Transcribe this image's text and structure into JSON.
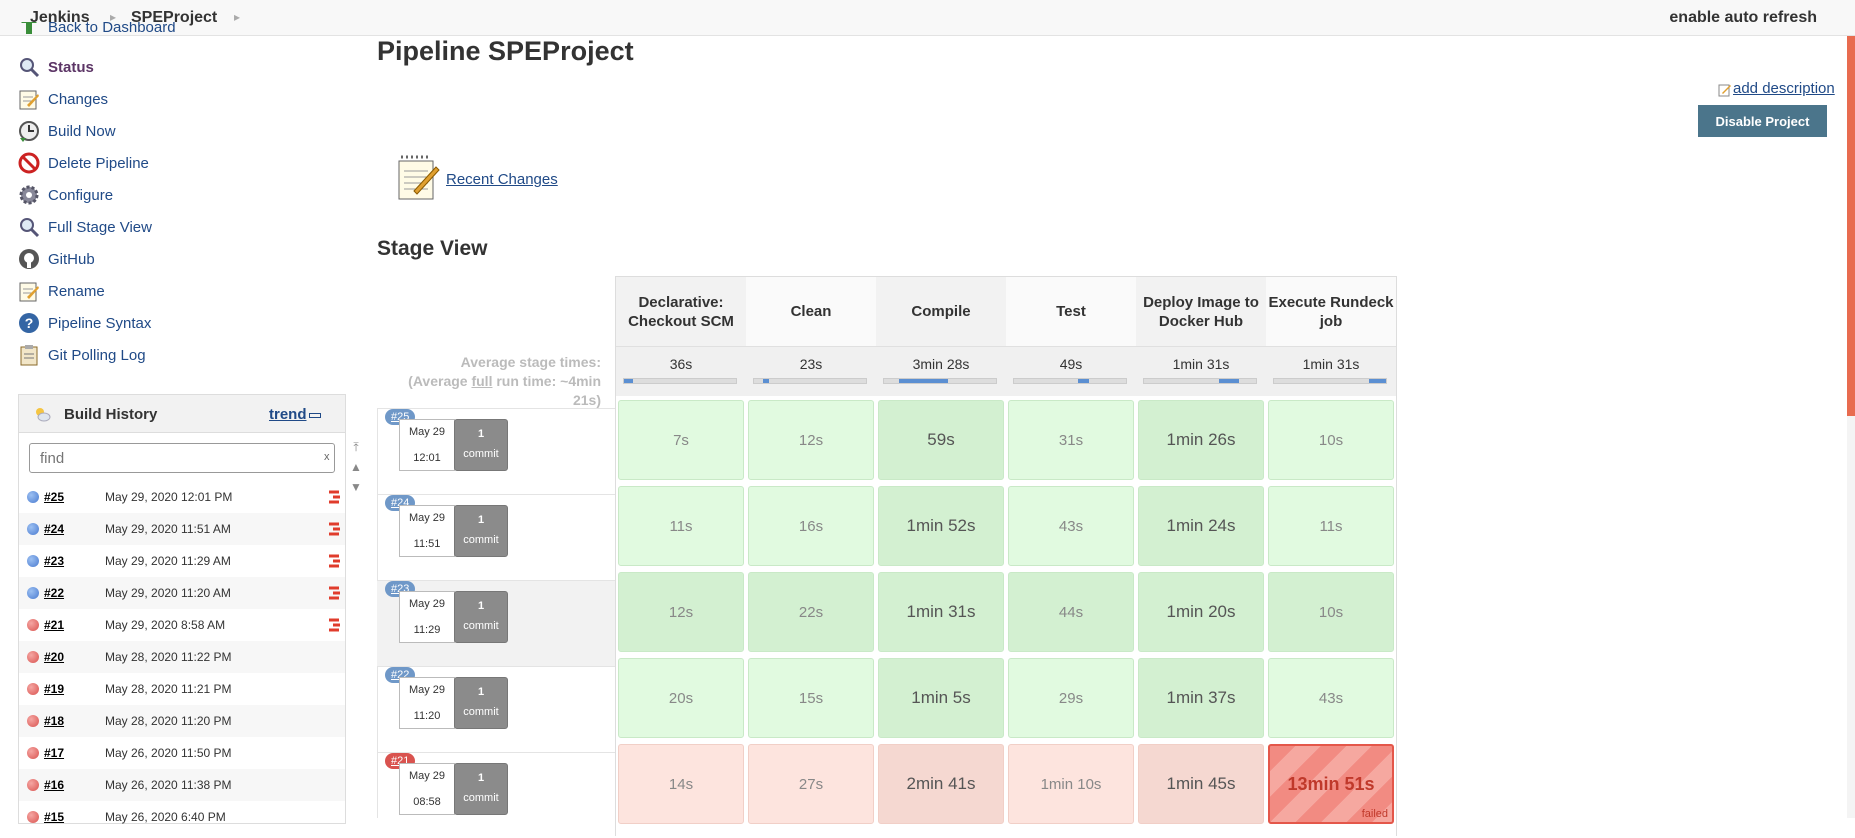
{
  "breadcrumb": {
    "home": "Jenkins",
    "project": "SPEProject"
  },
  "topbar": {
    "auto_refresh": "enable auto refresh"
  },
  "sidebar": {
    "items": [
      {
        "label": "Back to Dashboard",
        "icon": "up-arrow-icon"
      },
      {
        "label": "Status",
        "icon": "magnifier-icon"
      },
      {
        "label": "Changes",
        "icon": "notepad-icon"
      },
      {
        "label": "Build Now",
        "icon": "clock-icon"
      },
      {
        "label": "Delete Pipeline",
        "icon": "no-entry-icon"
      },
      {
        "label": "Configure",
        "icon": "gear-icon"
      },
      {
        "label": "Full Stage View",
        "icon": "magnifier-icon"
      },
      {
        "label": "GitHub",
        "icon": "github-icon"
      },
      {
        "label": "Rename",
        "icon": "notepad-icon"
      },
      {
        "label": "Pipeline Syntax",
        "icon": "help-icon"
      },
      {
        "label": "Git Polling Log",
        "icon": "clipboard-icon"
      }
    ]
  },
  "build_history": {
    "title": "Build History",
    "trend": "trend",
    "find_placeholder": "find",
    "find_clear": "x",
    "builds": [
      {
        "number": "#25",
        "date": "May 29, 2020 12:01 PM",
        "status": "success"
      },
      {
        "number": "#24",
        "date": "May 29, 2020 11:51 AM",
        "status": "success"
      },
      {
        "number": "#23",
        "date": "May 29, 2020 11:29 AM",
        "status": "success"
      },
      {
        "number": "#22",
        "date": "May 29, 2020 11:20 AM",
        "status": "success"
      },
      {
        "number": "#21",
        "date": "May 29, 2020 8:58 AM",
        "status": "failed"
      },
      {
        "number": "#20",
        "date": "May 28, 2020 11:22 PM",
        "status": "failed"
      },
      {
        "number": "#19",
        "date": "May 28, 2020 11:21 PM",
        "status": "failed"
      },
      {
        "number": "#18",
        "date": "May 28, 2020 11:20 PM",
        "status": "failed"
      },
      {
        "number": "#17",
        "date": "May 26, 2020 11:50 PM",
        "status": "failed"
      },
      {
        "number": "#16",
        "date": "May 26, 2020 11:38 PM",
        "status": "failed"
      },
      {
        "number": "#15",
        "date": "May 26, 2020 6:40 PM",
        "status": "failed"
      }
    ]
  },
  "main": {
    "title": "Pipeline SPEProject",
    "add_description": "add description",
    "disable_button": "Disable Project",
    "recent_changes": "Recent Changes",
    "stage_view_title": "Stage View",
    "avg_stage_label": "Average stage times:",
    "avg_run_prefix": "(Average ",
    "avg_run_full": "full",
    "avg_run_suffix": " run time: ~4min 21s)"
  },
  "stages": [
    {
      "name": "Declarative: Checkout SCM",
      "avg": "36s",
      "bar_start": 0.0,
      "bar_fraction": 0.08
    },
    {
      "name": "Clean",
      "avg": "23s",
      "bar_start": 0.08,
      "bar_fraction": 0.05
    },
    {
      "name": "Compile",
      "avg": "3min 28s",
      "bar_start": 0.13,
      "bar_fraction": 0.44
    },
    {
      "name": "Test",
      "avg": "49s",
      "bar_start": 0.57,
      "bar_fraction": 0.1
    },
    {
      "name": "Deploy Image to Docker Hub",
      "avg": "1min 31s",
      "bar_start": 0.67,
      "bar_fraction": 0.18
    },
    {
      "name": "Execute Rundeck job",
      "avg": "1min 31s",
      "bar_start": 0.85,
      "bar_fraction": 0.15
    }
  ],
  "runs": [
    {
      "badge": "#25",
      "date": "May 29",
      "time": "12:01",
      "commits": "1",
      "commit_label": "commit",
      "status": "success",
      "cells": [
        "7s",
        "12s",
        "59s",
        "31s",
        "1min 26s",
        "10s"
      ]
    },
    {
      "badge": "#24",
      "date": "May 29",
      "time": "11:51",
      "commits": "1",
      "commit_label": "commit",
      "status": "success",
      "cells": [
        "11s",
        "16s",
        "1min 52s",
        "43s",
        "1min 24s",
        "11s"
      ]
    },
    {
      "badge": "#23",
      "date": "May 29",
      "time": "11:29",
      "commits": "1",
      "commit_label": "commit",
      "status": "success",
      "cells": [
        "12s",
        "22s",
        "1min 31s",
        "44s",
        "1min 20s",
        "10s"
      ]
    },
    {
      "badge": "#22",
      "date": "May 29",
      "time": "11:20",
      "commits": "1",
      "commit_label": "commit",
      "status": "success",
      "cells": [
        "20s",
        "15s",
        "1min 5s",
        "29s",
        "1min 37s",
        "43s"
      ]
    },
    {
      "badge": "#21",
      "date": "May 29",
      "time": "08:58",
      "commits": "1",
      "commit_label": "commit",
      "status": "failed",
      "cells": [
        "14s",
        "27s",
        "2min 41s",
        "1min 10s",
        "1min 45s",
        "13min 51s"
      ],
      "failed_label": "failed"
    }
  ],
  "colors": {
    "success": "#4a7bd0",
    "failed": "#d9534f",
    "accent": "#4b758b",
    "link": "#204a87"
  }
}
